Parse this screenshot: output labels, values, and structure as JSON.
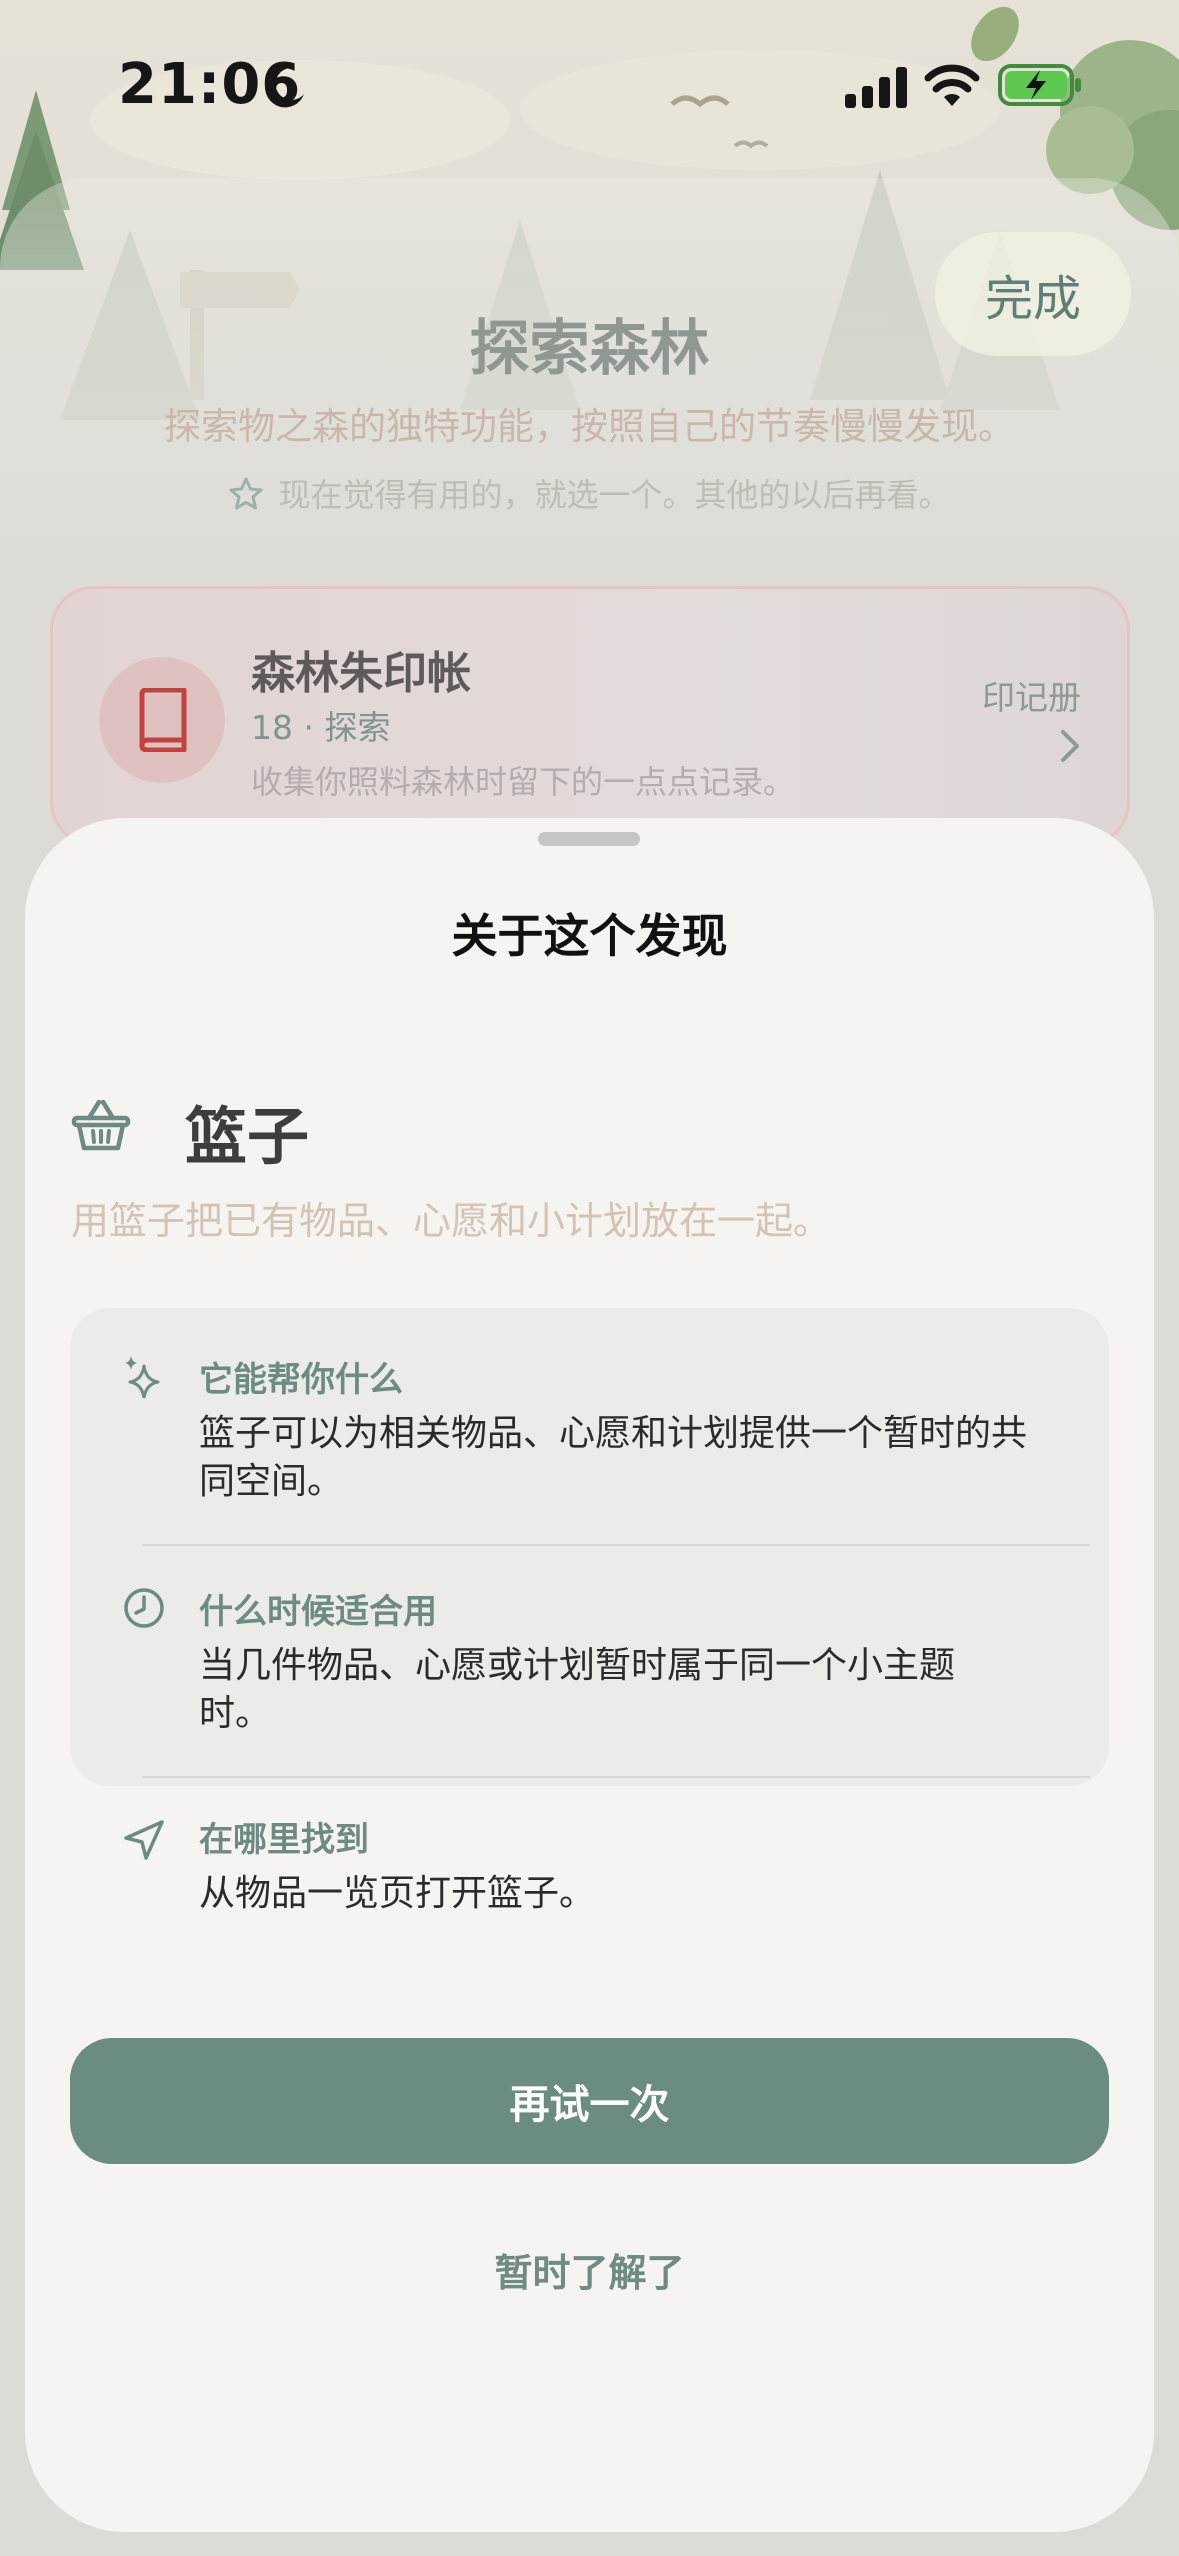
{
  "status_bar": {
    "time": "21:06"
  },
  "background_page": {
    "done_label": "完成",
    "title": "探索森林",
    "subtitle": "探索物之森的独特功能，按照自己的节奏慢慢发现。",
    "hint": "现在觉得有用的，就选一个。其他的以后再看。",
    "card": {
      "title": "森林朱印帐",
      "meta": "18 · 探索",
      "description": "收集你照料森林时留下的一点点记录。",
      "action_label": "印记册"
    }
  },
  "sheet": {
    "title": "关于这个发现",
    "feature_name": "篮子",
    "feature_summary": "用篮子把已有物品、心愿和小计划放在一起。",
    "sections": [
      {
        "icon": "sparkles-icon",
        "label": "它能帮你什么",
        "text": "篮子可以为相关物品、心愿和计划提供一个暂时的共同空间。"
      },
      {
        "icon": "clock-icon",
        "label": "什么时候适合用",
        "text": "当几件物品、心愿或计划暂时属于同一个小主题时。"
      },
      {
        "icon": "navigation-arrow-icon",
        "label": "在哪里找到",
        "text": "从物品一览页打开篮子。"
      }
    ],
    "primary_button": "再试一次",
    "secondary_link": "暂时了解了"
  },
  "colors": {
    "accent": "#6b8d80",
    "sheet_background": "#f5f4f0",
    "info_box": "#ebebe8",
    "summary_text": "#d4c2b3",
    "label_text": "#6c8b82"
  }
}
